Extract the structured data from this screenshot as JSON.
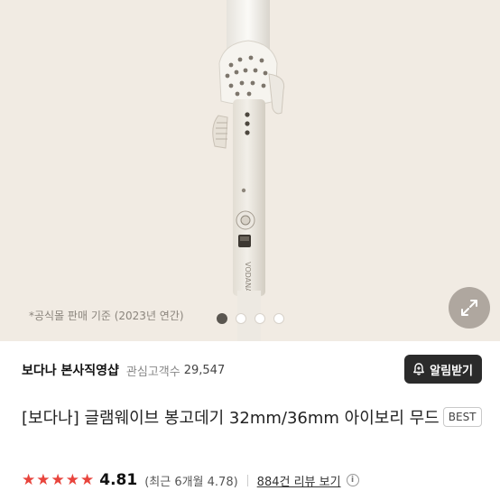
{
  "hero": {
    "caption": "*공식몰 판매 기준 (2023년 연간)",
    "brand_print": "VODANA",
    "carousel": {
      "total": 4,
      "active_index": 0
    },
    "background": "#f1ebe3"
  },
  "seller": {
    "name": "보다나 본사직영샵",
    "fans_label": "관심고객수",
    "fans_count": "29,547",
    "alarm_label": "알림받기"
  },
  "product": {
    "title": "[보다나] 글램웨이브 봉고데기 32mm/36mm 아이보리 무드",
    "badge": "BEST"
  },
  "rating": {
    "stars_filled": 5,
    "score": "4.81",
    "recent": "(최근 6개월 4.78)",
    "review_link": "884건 리뷰 보기",
    "info_glyph": "i"
  },
  "colors": {
    "accent_star": "#e8443c",
    "alarm_button": "#2b2b2b"
  },
  "icons": {
    "expand": "expand-icon",
    "bell": "bell-plus-icon",
    "info": "info-icon"
  }
}
